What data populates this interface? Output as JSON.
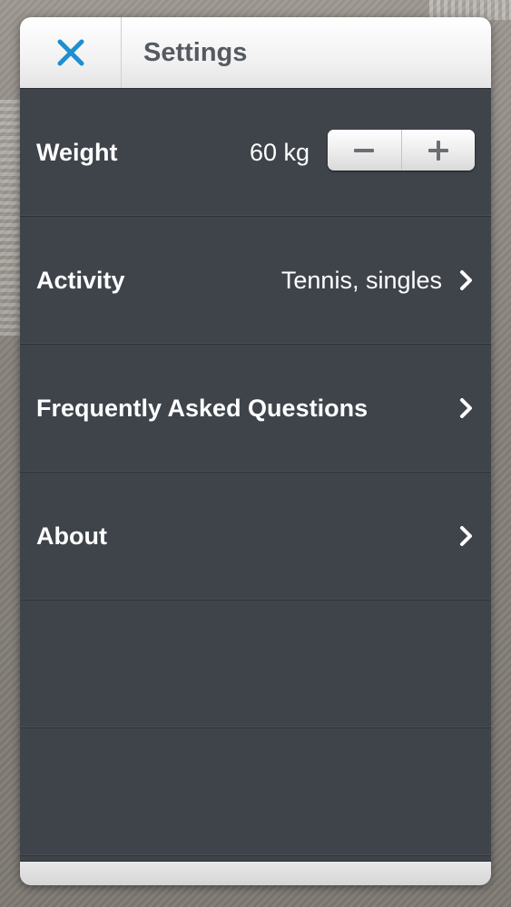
{
  "header": {
    "close_icon": "close-x-icon",
    "title": "Settings"
  },
  "settings": {
    "weight": {
      "label": "Weight",
      "value": "60 kg",
      "decrement_icon": "minus-icon",
      "increment_icon": "plus-icon"
    },
    "activity": {
      "label": "Activity",
      "value": "Tennis, singles",
      "icon": "chevron-right-icon"
    },
    "faq": {
      "label": "Frequently Asked Questions",
      "icon": "chevron-right-icon"
    },
    "about": {
      "label": "About",
      "icon": "chevron-right-icon"
    }
  },
  "colors": {
    "accent": "#1e8fd0",
    "panel_background": "#3f444b",
    "header_background": "#f2f2f2",
    "title_text": "#555a60",
    "row_text": "#ffffff"
  }
}
